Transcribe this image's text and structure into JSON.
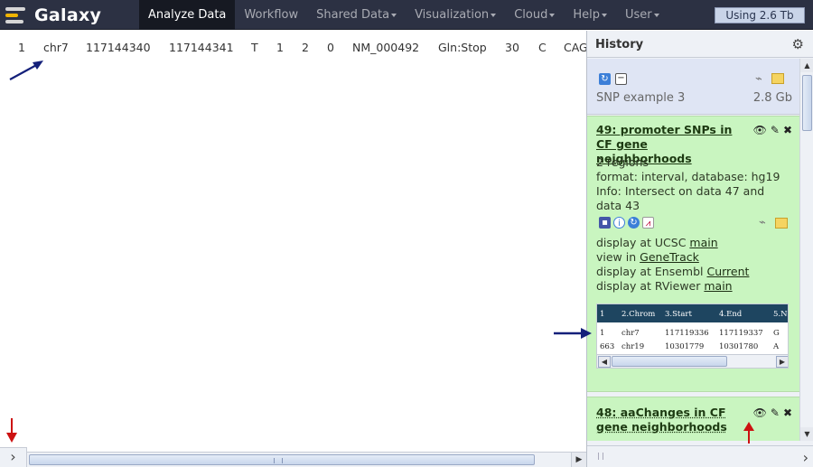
{
  "masthead": {
    "logo_text": "Galaxy",
    "tabs": [
      {
        "label": "Analyze Data",
        "active": true,
        "dropdown": false
      },
      {
        "label": "Workflow",
        "active": false,
        "dropdown": false
      },
      {
        "label": "Shared Data",
        "active": false,
        "dropdown": true
      },
      {
        "label": "Visualization",
        "active": false,
        "dropdown": true
      },
      {
        "label": "Cloud",
        "active": false,
        "dropdown": true
      },
      {
        "label": "Help",
        "active": false,
        "dropdown": true
      },
      {
        "label": "User",
        "active": false,
        "dropdown": true
      }
    ],
    "quota": "Using 2.6 Tb"
  },
  "center": {
    "row": [
      "1",
      "chr7",
      "117144340",
      "117144341",
      "T",
      "1",
      "2",
      "0",
      "NM_000492",
      "Gln:Stop",
      "30",
      "C",
      "CAG"
    ]
  },
  "history": {
    "title": "History",
    "name": "SNP example 3",
    "size": "2.8 Gb",
    "datasets": [
      {
        "title": "49: promoter SNPs in CF gene neighborhoods",
        "regions": "2 regions",
        "format": "format: interval, database: hg19",
        "info": "Info: Intersect on data 47 and data 43",
        "display_lines": [
          {
            "prefix": "display at UCSC ",
            "link": "main"
          },
          {
            "prefix": "view in ",
            "link": "GeneTrack"
          },
          {
            "prefix": "display at Ensembl ",
            "link": "Current"
          },
          {
            "prefix": "display at RViewer ",
            "link": "main"
          }
        ],
        "peek": {
          "header": [
            "1",
            "2.Chrom",
            "3.Start",
            "4.End",
            "5.N"
          ],
          "rows": [
            [
              "1",
              "chr7",
              "117119336",
              "117119337",
              "G"
            ],
            [
              "663",
              "chr19",
              "10301779",
              "10301780",
              "A"
            ]
          ]
        }
      },
      {
        "title": "48: aaChanges in CF gene neighborhoods"
      }
    ]
  },
  "colors": {
    "masthead_bg": "#2c3143",
    "active_tab_bg": "#161922",
    "dataset_ok_bg": "#c9f5c0",
    "arrow_blue": "#14207a",
    "arrow_red": "#cc1111"
  }
}
